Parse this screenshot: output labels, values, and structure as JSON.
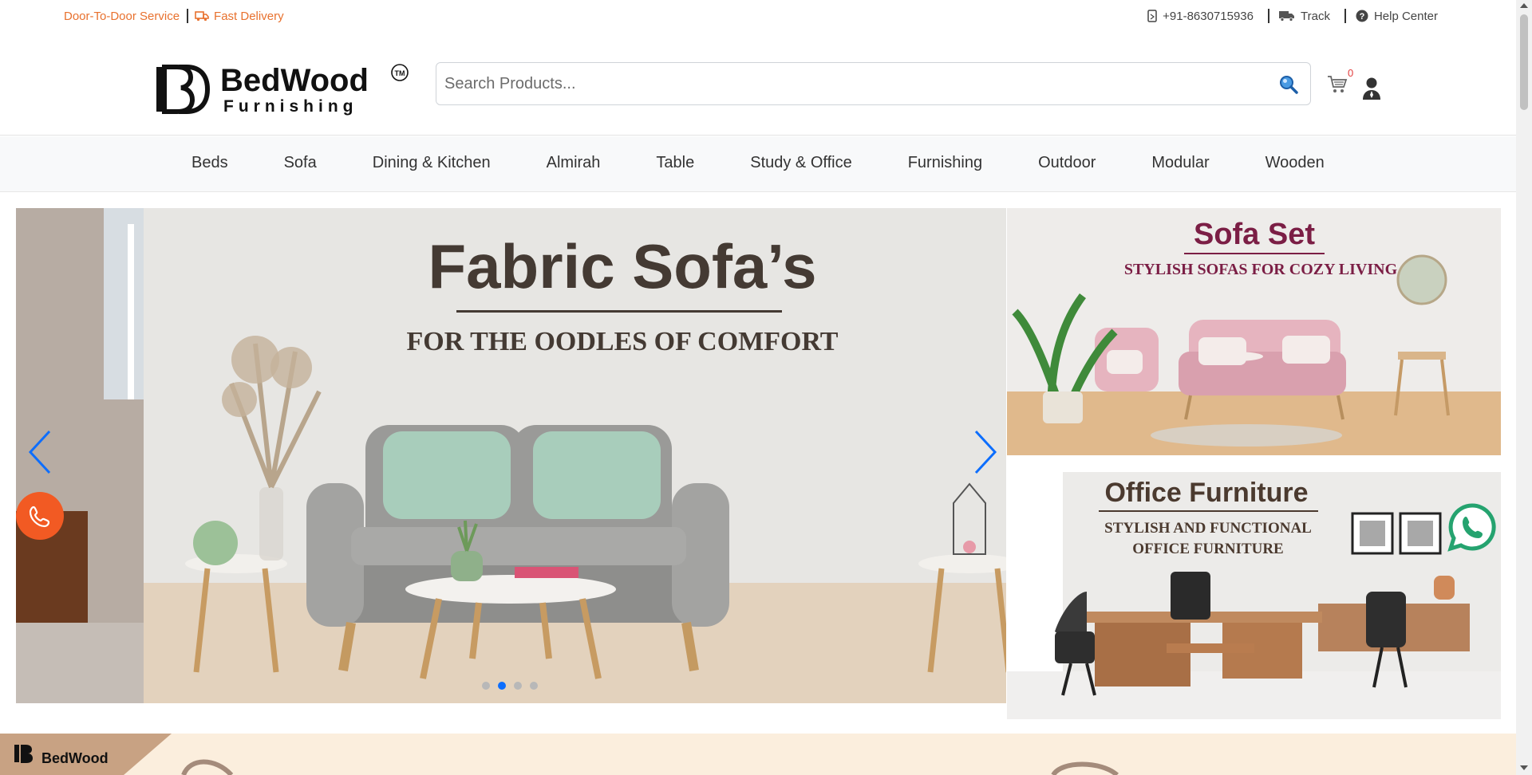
{
  "topbar": {
    "service": "Door-To-Door Service",
    "delivery": "Fast Delivery",
    "phone": "+91-8630715936",
    "track": "Track",
    "help": "Help Center"
  },
  "brand": {
    "mark": "BD",
    "name": "BedWood",
    "tagline": "Furnishing",
    "tm": "TM"
  },
  "search": {
    "placeholder": "Search Products..."
  },
  "cart": {
    "count": "0"
  },
  "nav": {
    "items": [
      "Beds",
      "Sofa",
      "Dining & Kitchen",
      "Almirah",
      "Table",
      "Study & Office",
      "Furnishing",
      "Outdoor",
      "Modular",
      "Wooden"
    ]
  },
  "hero": {
    "title": "Fabric Sofa’s",
    "subtitle": "FOR THE OODLES OF COMFORT",
    "slides": 4,
    "active_slide": 2
  },
  "side_banner_1": {
    "title": "Sofa Set",
    "subtitle": "STYLISH SOFAS FOR COZY LIVING"
  },
  "side_banner_2": {
    "title": "Office Furniture",
    "subtitle_line1": "STYLISH AND FUNCTIONAL",
    "subtitle_line2": "OFFICE FURNITURE"
  },
  "colors": {
    "accent_orange": "#e8712e",
    "call_button": "#f25a23",
    "whatsapp": "#25a36f",
    "slider_arrow": "#0d6efd",
    "banner_title": "#7b1e45"
  },
  "icons": [
    "phone-icon",
    "truck-icon",
    "mobile-icon",
    "track-truck-icon",
    "help-icon",
    "search-icon",
    "cart-icon",
    "user-icon",
    "whatsapp-icon",
    "chevron-left-icon",
    "chevron-right-icon"
  ]
}
